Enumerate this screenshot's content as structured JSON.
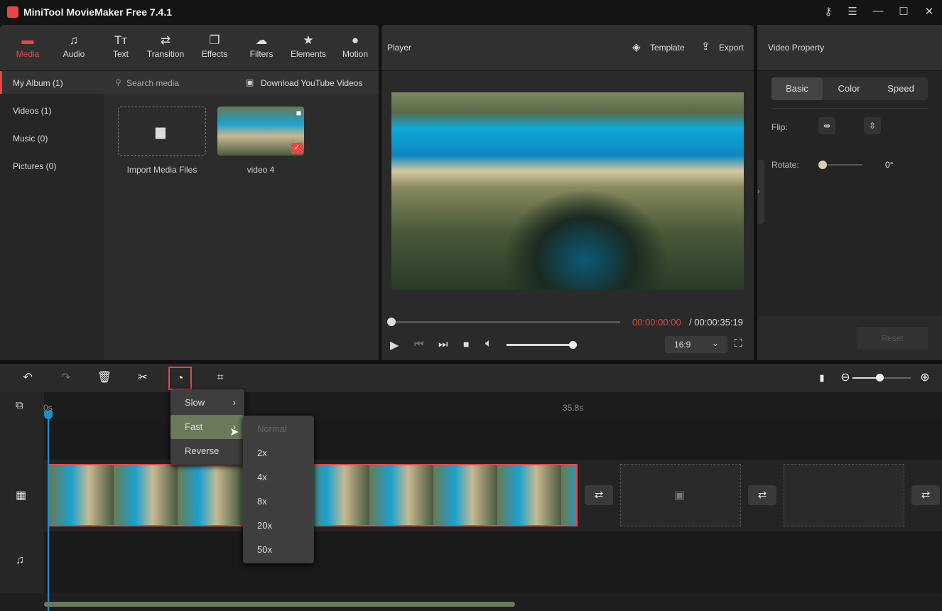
{
  "app": {
    "title": "MiniTool MovieMaker Free 7.4.1"
  },
  "tabs": [
    {
      "label": "Media",
      "icon": "folder-icon"
    },
    {
      "label": "Audio",
      "icon": "music-icon"
    },
    {
      "label": "Text",
      "icon": "text-icon"
    },
    {
      "label": "Transition",
      "icon": "transition-icon"
    },
    {
      "label": "Effects",
      "icon": "effects-icon"
    },
    {
      "label": "Filters",
      "icon": "filters-icon"
    },
    {
      "label": "Elements",
      "icon": "elements-icon"
    },
    {
      "label": "Motion",
      "icon": "motion-icon"
    }
  ],
  "sidebar": [
    {
      "label": "My Album (1)"
    },
    {
      "label": "Videos (1)"
    },
    {
      "label": "Music (0)"
    },
    {
      "label": "Pictures (0)"
    }
  ],
  "media": {
    "search_placeholder": "Search media",
    "download": "Download YouTube Videos",
    "import": "Import Media Files",
    "items": [
      {
        "name": "video 4"
      }
    ]
  },
  "player": {
    "title": "Player",
    "template": "Template",
    "export": "Export",
    "current_time": "00:00:00:00",
    "total_time": "/ 00:00:35:19",
    "aspect": "16:9",
    "volume": 0.95,
    "progress": 0
  },
  "property": {
    "title": "Video Property",
    "tabs": [
      "Basic",
      "Color",
      "Speed"
    ],
    "flip_label": "Flip:",
    "rotate_label": "Rotate:",
    "rotate_value": "0°",
    "reset": "Reset"
  },
  "timeline": {
    "start": "0s",
    "end": "35.8s"
  },
  "speed_menu": {
    "items": [
      "Slow",
      "Fast",
      "Reverse"
    ],
    "selected": "Fast",
    "submenu": [
      "Normal",
      "2x",
      "4x",
      "8x",
      "20x",
      "50x"
    ],
    "disabled": "Normal"
  },
  "colors": {
    "accent": "#e84545",
    "playhead": "#1e90c8"
  }
}
